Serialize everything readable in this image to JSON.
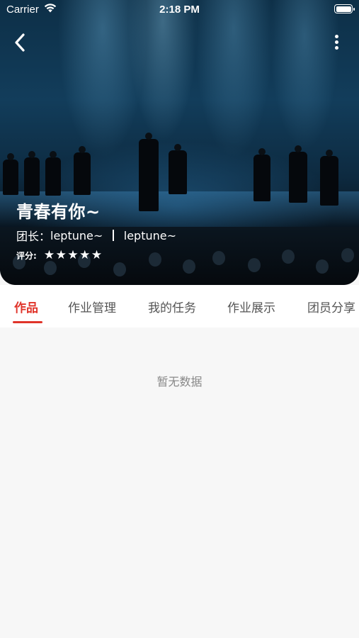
{
  "status_bar": {
    "carrier": "Carrier",
    "time": "2:18 PM",
    "wifi_icon": "wifi-icon",
    "battery_icon": "battery-icon"
  },
  "header": {
    "back_icon": "chevron-left-icon",
    "more_icon": "more-vertical-icon"
  },
  "group": {
    "title": "青春有你~",
    "leader_label": "团长：",
    "leader_name": "leptune~",
    "leader_alias": "leptune~",
    "rating_label": "评分:",
    "rating_stars": 5,
    "rating_max": 5,
    "star_glyph": "★"
  },
  "tabs": [
    {
      "label": "作品",
      "active": true
    },
    {
      "label": "作业管理",
      "active": false
    },
    {
      "label": "我的任务",
      "active": false
    },
    {
      "label": "作业展示",
      "active": false
    },
    {
      "label": "团员分享",
      "active": false
    }
  ],
  "content": {
    "empty_text": "暂无数据"
  },
  "colors": {
    "accent": "#e0342a",
    "background": "#f7f7f7",
    "tab_text": "#555555",
    "empty_text": "#888888"
  }
}
